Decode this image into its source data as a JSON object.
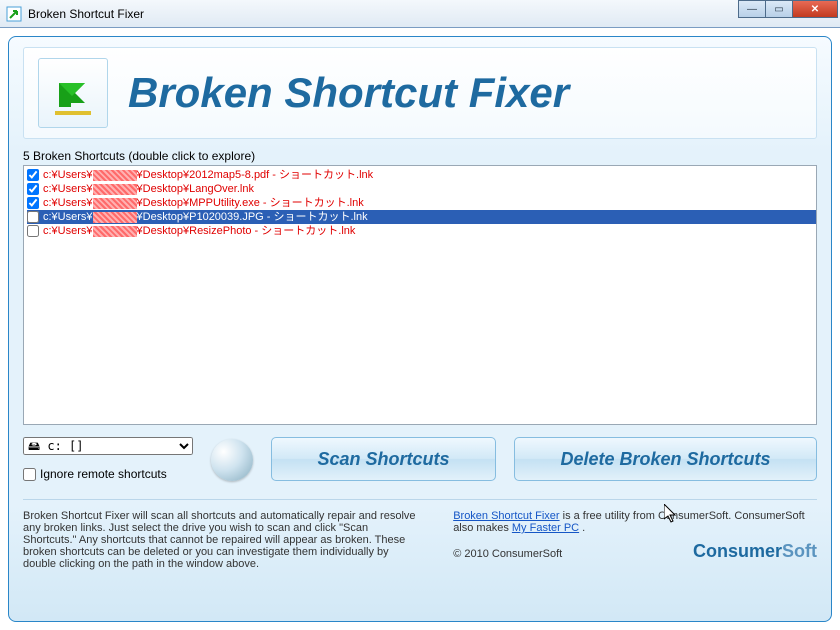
{
  "window": {
    "title": "Broken Shortcut Fixer"
  },
  "banner": {
    "title": "Broken Shortcut Fixer"
  },
  "list": {
    "header": "5 Broken Shortcuts (double click to explore)",
    "rows": [
      {
        "checked": true,
        "pre": "c:¥Users¥",
        "post": "¥Desktop¥2012map5-8.pdf - ショートカット.lnk"
      },
      {
        "checked": true,
        "pre": "c:¥Users¥",
        "post": "¥Desktop¥LangOver.lnk"
      },
      {
        "checked": true,
        "pre": "c:¥Users¥",
        "post": "¥Desktop¥MPPUtility.exe - ショートカット.lnk"
      },
      {
        "checked": false,
        "selected": true,
        "pre": "c:¥Users¥",
        "post": "¥Desktop¥P1020039.JPG - ショートカット.lnk"
      },
      {
        "checked": false,
        "pre": "c:¥Users¥",
        "post": "¥Desktop¥ResizePhoto - ショートカット.lnk"
      }
    ]
  },
  "controls": {
    "drive_option": "🖴 c: []",
    "ignore_label": "Ignore remote shortcuts",
    "scan_label": "Scan Shortcuts",
    "delete_label": "Delete Broken Shortcuts"
  },
  "footer": {
    "left_text": "Broken Shortcut Fixer will scan all shortcuts and automatically repair and resolve any broken links. Just select the drive you wish to scan and click \"Scan Shortcuts.\" Any shortcuts that cannot be repaired will appear as broken. These broken shortcuts can be deleted or you can investigate them individually by double clicking on the path in the window above.",
    "link1": "Broken Shortcut Fixer",
    "right_mid": " is a free utility from ConsumerSoft. ConsumerSoft also makes ",
    "link2": "My Faster PC",
    "right_end": " .",
    "copyright": "© 2010 ConsumerSoft",
    "brand1": "Consumer",
    "brand2": "Soft"
  }
}
